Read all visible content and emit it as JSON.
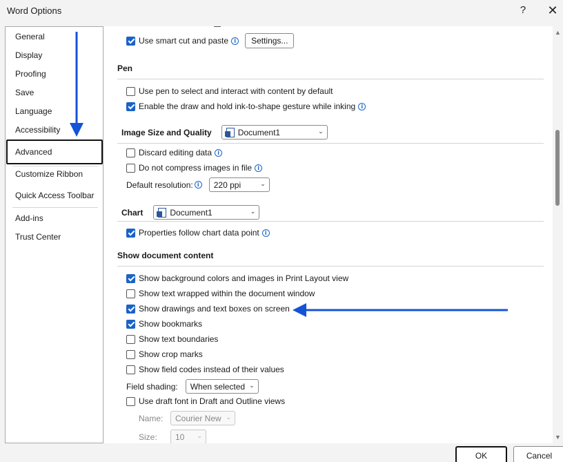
{
  "window": {
    "title": "Word Options",
    "help_glyph": "?",
    "close_glyph": "✕"
  },
  "sidebar": {
    "items": [
      {
        "label": "General"
      },
      {
        "label": "Display"
      },
      {
        "label": "Proofing"
      },
      {
        "label": "Save"
      },
      {
        "label": "Language"
      },
      {
        "label": "Accessibility"
      },
      {
        "label": "Advanced",
        "selected": true
      },
      {
        "label": "Customize Ribbon"
      },
      {
        "label": "Quick Access Toolbar"
      },
      {
        "label": "Add-ins"
      },
      {
        "label": "Trust Center"
      }
    ]
  },
  "cut_paste": {
    "smart_cut_paste": {
      "label": "Use smart cut and paste",
      "checked": true
    },
    "settings_button": "Settings..."
  },
  "pen": {
    "heading": "Pen",
    "use_pen": {
      "label": "Use pen to select and interact with content by default",
      "checked": false
    },
    "ink_to_shape": {
      "label": "Enable the draw and hold ink-to-shape gesture while inking",
      "checked": true
    }
  },
  "image_size": {
    "heading": "Image Size and Quality",
    "document": "Document1",
    "discard_editing": {
      "label": "Discard editing data",
      "checked": false
    },
    "no_compress": {
      "label": "Do not compress images in file",
      "checked": false
    },
    "default_resolution_label": "Default resolution:",
    "default_resolution_value": "220 ppi"
  },
  "chart": {
    "heading": "Chart",
    "document": "Document1",
    "properties_follow": {
      "label": "Properties follow chart data point",
      "checked": true
    }
  },
  "show_content": {
    "heading": "Show document content",
    "background_colors": {
      "label": "Show background colors and images in Print Layout view",
      "checked": true
    },
    "text_wrapped": {
      "label": "Show text wrapped within the document window",
      "checked": false
    },
    "drawings_text_boxes": {
      "label": "Show drawings and text boxes on screen",
      "checked": true
    },
    "bookmarks": {
      "label": "Show bookmarks",
      "checked": true
    },
    "text_boundaries": {
      "label": "Show text boundaries",
      "checked": false
    },
    "crop_marks": {
      "label": "Show crop marks",
      "checked": false
    },
    "field_codes": {
      "label": "Show field codes instead of their values",
      "checked": false
    },
    "field_shading_label": "Field shading:",
    "field_shading_value": "When selected",
    "draft_font": {
      "label": "Use draft font in Draft and Outline views",
      "checked": false
    },
    "name_label": "Name:",
    "name_value": "Courier New",
    "size_label": "Size:",
    "size_value": "10"
  },
  "footer": {
    "ok": "OK",
    "cancel": "Cancel"
  },
  "colors": {
    "accent": "#1a63c7",
    "annotation_arrow": "#1553d6"
  }
}
